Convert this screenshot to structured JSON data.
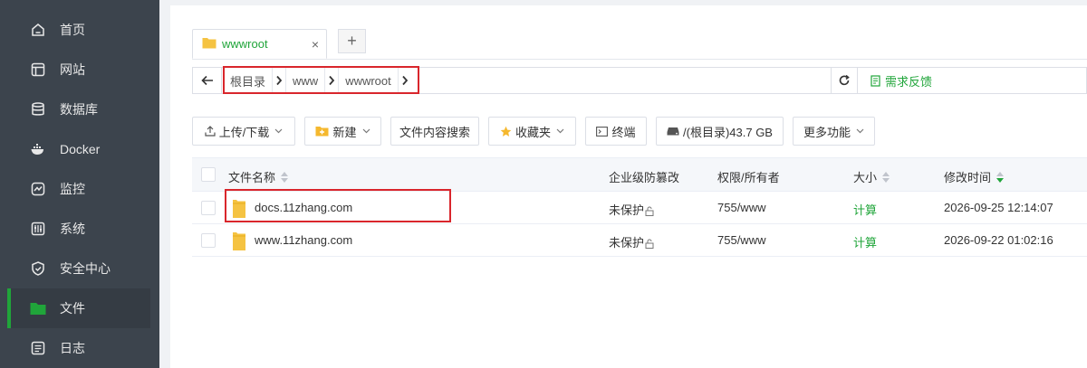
{
  "sidebar": {
    "items": [
      {
        "label": "首页",
        "icon": "home-icon"
      },
      {
        "label": "网站",
        "icon": "website-icon"
      },
      {
        "label": "数据库",
        "icon": "database-icon"
      },
      {
        "label": "Docker",
        "icon": "docker-icon"
      },
      {
        "label": "监控",
        "icon": "monitor-icon"
      },
      {
        "label": "系统",
        "icon": "system-icon"
      },
      {
        "label": "安全中心",
        "icon": "shield-icon"
      },
      {
        "label": "文件",
        "icon": "folder-icon",
        "active": true
      },
      {
        "label": "日志",
        "icon": "log-icon"
      }
    ]
  },
  "tabs": [
    {
      "label": "wwwroot",
      "close": "×"
    }
  ],
  "tab_add": "+",
  "address": {
    "crumbs": [
      "根目录",
      "www",
      "wwwroot"
    ],
    "feedback": "需求反馈"
  },
  "toolbar": {
    "upload": "上传/下载",
    "new": "新建",
    "search_content": "文件内容搜索",
    "favorites": "收藏夹",
    "terminal": "终端",
    "disk": "/(根目录)43.7 GB",
    "more": "更多功能"
  },
  "table": {
    "headers": {
      "name": "文件名称",
      "protect": "企业级防篡改",
      "perm": "权限/所有者",
      "size": "大小",
      "mtime": "修改时间"
    },
    "rows": [
      {
        "name": "docs.11zhang.com",
        "protect": "未保护",
        "perm": "755/www",
        "size": "计算",
        "mtime": "2026-09-25 12:14:07"
      },
      {
        "name": "www.11zhang.com",
        "protect": "未保护",
        "perm": "755/www",
        "size": "计算",
        "mtime": "2026-09-22 01:02:16"
      }
    ]
  },
  "colors": {
    "accent": "#20a53a",
    "sidebar_bg": "#3c444d",
    "highlight": "#d9262c"
  }
}
